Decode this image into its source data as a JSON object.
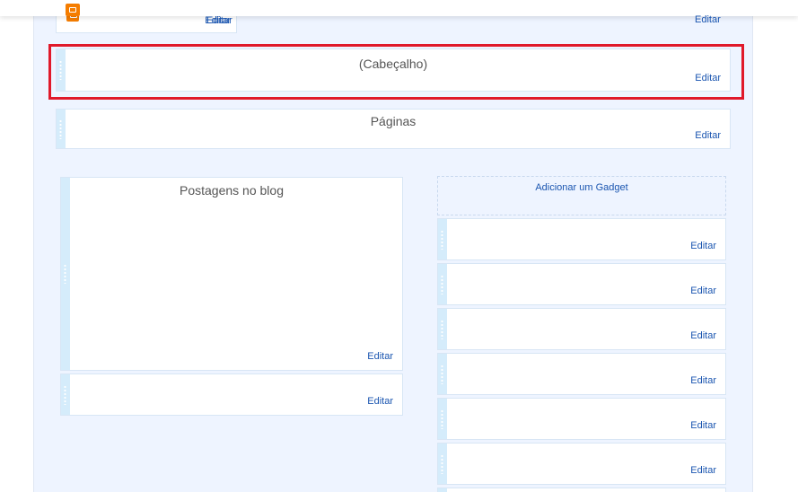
{
  "header": {
    "title": "(Cabeçalho)",
    "edit_label": "Editar"
  },
  "top_gadget": {
    "edit_label": "Editar"
  },
  "top_right": {
    "edit_label": "Editar"
  },
  "pages": {
    "title": "Páginas",
    "edit_label": "Editar"
  },
  "main": {
    "posts": {
      "title": "Postagens no blog",
      "edit_label": "Editar"
    },
    "below_posts": {
      "edit_label": "Editar"
    }
  },
  "sidebar": {
    "add_gadget_label": "Adicionar um Gadget",
    "gadgets": [
      {
        "edit_label": "Editar"
      },
      {
        "edit_label": "Editar"
      },
      {
        "edit_label": "Editar"
      },
      {
        "edit_label": "Editar"
      },
      {
        "edit_label": "Editar"
      },
      {
        "edit_label": "Editar"
      }
    ]
  },
  "colors": {
    "highlight": "#e0192a",
    "link": "#1a55b0",
    "canvas": "#eef4ff",
    "blogger_icon": "#f57d00"
  },
  "icons": [
    "blogger-icon",
    "drag-handle-icon"
  ]
}
